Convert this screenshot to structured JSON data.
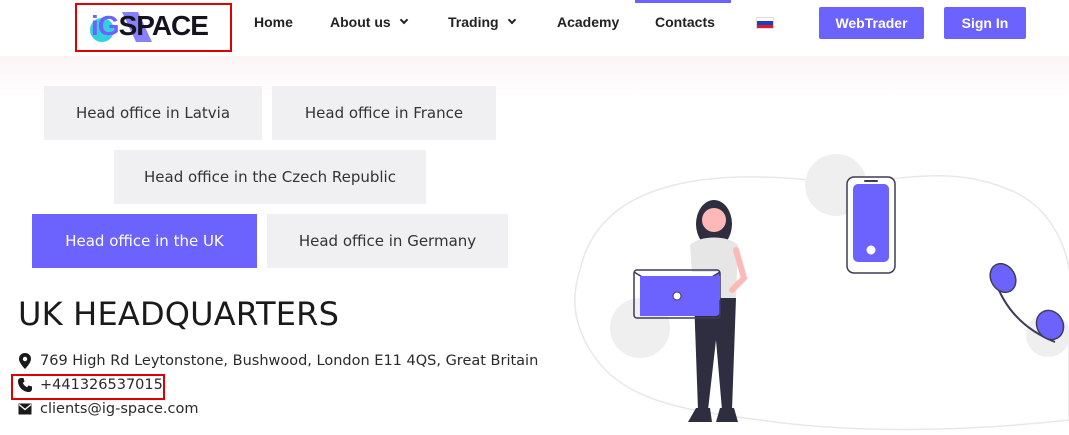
{
  "header": {
    "logo": {
      "ig": "iG",
      "rest": "SPACE"
    },
    "nav": [
      {
        "label": "Home",
        "has_dropdown": false
      },
      {
        "label": "About us",
        "has_dropdown": true
      },
      {
        "label": "Trading",
        "has_dropdown": true
      },
      {
        "label": "Academy",
        "has_dropdown": false
      },
      {
        "label": "Contacts",
        "has_dropdown": false,
        "active": true
      }
    ],
    "language_flag": "russia-flag-icon",
    "buttons": {
      "webtrader": "WebTrader",
      "signin": "Sign In"
    }
  },
  "offices": {
    "tabs": [
      {
        "label": "Head office in Latvia",
        "active": false
      },
      {
        "label": "Head office in France",
        "active": false
      },
      {
        "label": "Head office in the Czech Republic",
        "active": false
      },
      {
        "label": "Head office in the UK",
        "active": true
      },
      {
        "label": "Head office in Germany",
        "active": false
      }
    ]
  },
  "headquarters": {
    "title": "UK HEADQUARTERS",
    "address": "769 High Rd Leytonstone, Bushwood, London E11 4QS, Great Britain",
    "phone": "+441326537015",
    "email": "clients@ig-space.com",
    "icons": {
      "address": "map-marker-icon",
      "phone": "phone-icon",
      "email": "envelope-icon"
    }
  },
  "colors": {
    "accent": "#6c63ff",
    "tab_bg": "#f0f0f2",
    "highlight_box": "#e00000",
    "text": "#1a1a1a"
  }
}
